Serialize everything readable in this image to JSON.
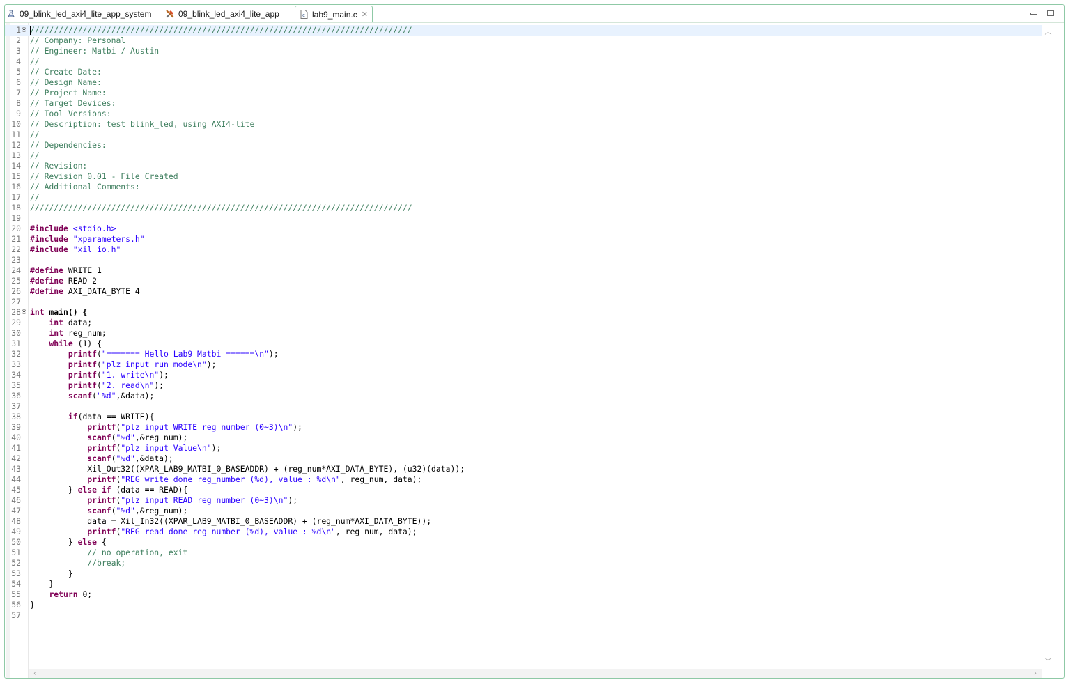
{
  "tabs": [
    {
      "label": "09_blink_led_axi4_lite_app_system",
      "icon": "system-project-icon",
      "active": false
    },
    {
      "label": "09_blink_led_axi4_lite_app",
      "icon": "application-project-icon",
      "active": false
    },
    {
      "label": "lab9_main.c",
      "icon": "c-file-icon",
      "active": true,
      "closable": true
    }
  ],
  "window_controls": {
    "minimize": "minimize-icon",
    "maximize": "maximize-icon"
  },
  "colors": {
    "comment": "#3f7f5f",
    "keyword": "#7f0055",
    "string": "#2a00ff",
    "line_number": "#787878",
    "tab_border": "#8fc9a6",
    "current_line": "#e8f2fe"
  },
  "code": {
    "lines": [
      {
        "n": "1",
        "text": "////////////////////////////////////////////////////////////////////////////////",
        "kind": "com",
        "fold": true
      },
      {
        "n": "2",
        "text": "// Company: Personal",
        "kind": "com"
      },
      {
        "n": "3",
        "text": "// Engineer: Matbi / Austin",
        "kind": "com"
      },
      {
        "n": "4",
        "text": "//",
        "kind": "com"
      },
      {
        "n": "5",
        "text": "// Create Date:",
        "kind": "com"
      },
      {
        "n": "6",
        "text": "// Design Name:",
        "kind": "com"
      },
      {
        "n": "7",
        "text": "// Project Name:",
        "kind": "com"
      },
      {
        "n": "8",
        "text": "// Target Devices:",
        "kind": "com"
      },
      {
        "n": "9",
        "text": "// Tool Versions:",
        "kind": "com"
      },
      {
        "n": "10",
        "text": "// Description: test blink_led, using AXI4-lite",
        "kind": "com"
      },
      {
        "n": "11",
        "text": "//",
        "kind": "com"
      },
      {
        "n": "12",
        "text": "// Dependencies:",
        "kind": "com"
      },
      {
        "n": "13",
        "text": "//",
        "kind": "com"
      },
      {
        "n": "14",
        "text": "// Revision:",
        "kind": "com"
      },
      {
        "n": "15",
        "text": "// Revision 0.01 - File Created",
        "kind": "com"
      },
      {
        "n": "16",
        "text": "// Additional Comments:",
        "kind": "com"
      },
      {
        "n": "17",
        "text": "//",
        "kind": "com"
      },
      {
        "n": "18",
        "text": "////////////////////////////////////////////////////////////////////////////////",
        "kind": "com"
      },
      {
        "n": "19",
        "text": "",
        "kind": "plain"
      },
      {
        "n": "20",
        "kw": "#include",
        "rest": " <stdio.h>",
        "kind": "inc"
      },
      {
        "n": "21",
        "kw": "#include",
        "rest": " \"xparameters.h\"",
        "kind": "inc"
      },
      {
        "n": "22",
        "kw": "#include",
        "rest": " \"xil_io.h\"",
        "kind": "inc"
      },
      {
        "n": "23",
        "text": "",
        "kind": "plain"
      },
      {
        "n": "24",
        "kw": "#define",
        "rest": " WRITE 1",
        "kind": "def"
      },
      {
        "n": "25",
        "kw": "#define",
        "rest": " READ 2",
        "kind": "def"
      },
      {
        "n": "26",
        "kw": "#define",
        "rest": " AXI_DATA_BYTE 4",
        "kind": "def"
      },
      {
        "n": "27",
        "text": "",
        "kind": "plain"
      },
      {
        "n": "28",
        "kw": "int",
        "rest": " main() {",
        "kind": "main",
        "fold": true
      },
      {
        "n": "29",
        "indent": "    ",
        "kw": "int",
        "rest": " data;",
        "kind": "decl"
      },
      {
        "n": "30",
        "indent": "    ",
        "kw": "int",
        "rest": " reg_num;",
        "kind": "decl"
      },
      {
        "n": "31",
        "indent": "    ",
        "kw": "while",
        "rest": " (1) {",
        "kind": "decl"
      },
      {
        "n": "32",
        "indent": "        ",
        "fn": "printf",
        "pre": "(",
        "str": "\"======= Hello Lab9 Matbi ======\\n\"",
        "post": ");",
        "kind": "call"
      },
      {
        "n": "33",
        "indent": "        ",
        "fn": "printf",
        "pre": "(",
        "str": "\"plz input run mode\\n\"",
        "post": ");",
        "kind": "call"
      },
      {
        "n": "34",
        "indent": "        ",
        "fn": "printf",
        "pre": "(",
        "str": "\"1. write\\n\"",
        "post": ");",
        "kind": "call"
      },
      {
        "n": "35",
        "indent": "        ",
        "fn": "printf",
        "pre": "(",
        "str": "\"2. read\\n\"",
        "post": ");",
        "kind": "call"
      },
      {
        "n": "36",
        "indent": "        ",
        "fn": "scanf",
        "pre": "(",
        "str": "\"%d\"",
        "post": ",&data);",
        "kind": "call"
      },
      {
        "n": "37",
        "text": "",
        "kind": "plain"
      },
      {
        "n": "38",
        "indent": "        ",
        "kw": "if",
        "rest": "(data == WRITE){",
        "kind": "decl"
      },
      {
        "n": "39",
        "indent": "            ",
        "fn": "printf",
        "pre": "(",
        "str": "\"plz input WRITE reg number (0~3)\\n\"",
        "post": ");",
        "kind": "call"
      },
      {
        "n": "40",
        "indent": "            ",
        "fn": "scanf",
        "pre": "(",
        "str": "\"%d\"",
        "post": ",&reg_num);",
        "kind": "call"
      },
      {
        "n": "41",
        "indent": "            ",
        "fn": "printf",
        "pre": "(",
        "str": "\"plz input Value\\n\"",
        "post": ");",
        "kind": "call"
      },
      {
        "n": "42",
        "indent": "            ",
        "fn": "scanf",
        "pre": "(",
        "str": "\"%d\"",
        "post": ",&data);",
        "kind": "call"
      },
      {
        "n": "43",
        "text": "            Xil_Out32((XPAR_LAB9_MATBI_0_BASEADDR) + (reg_num*AXI_DATA_BYTE), (u32)(data));",
        "kind": "plain"
      },
      {
        "n": "44",
        "indent": "            ",
        "fn": "printf",
        "pre": "(",
        "str": "\"REG write done reg_number (%d), value : %d\\n\"",
        "post": ", reg_num, data);",
        "kind": "call"
      },
      {
        "n": "45",
        "indent": "        } ",
        "kw": "else if",
        "rest": " (data == READ){",
        "kind": "decl"
      },
      {
        "n": "46",
        "indent": "            ",
        "fn": "printf",
        "pre": "(",
        "str": "\"plz input READ reg number (0~3)\\n\"",
        "post": ");",
        "kind": "call"
      },
      {
        "n": "47",
        "indent": "            ",
        "fn": "scanf",
        "pre": "(",
        "str": "\"%d\"",
        "post": ",&reg_num);",
        "kind": "call"
      },
      {
        "n": "48",
        "text": "            data = Xil_In32((XPAR_LAB9_MATBI_0_BASEADDR) + (reg_num*AXI_DATA_BYTE));",
        "kind": "plain"
      },
      {
        "n": "49",
        "indent": "            ",
        "fn": "printf",
        "pre": "(",
        "str": "\"REG read done reg_number (%d), value : %d\\n\"",
        "post": ", reg_num, data);",
        "kind": "call"
      },
      {
        "n": "50",
        "indent": "        } ",
        "kw": "else",
        "rest": " {",
        "kind": "decl"
      },
      {
        "n": "51",
        "indent": "            ",
        "com": "// no operation, exit",
        "kind": "icom"
      },
      {
        "n": "52",
        "indent": "            ",
        "com": "//break;",
        "kind": "icom"
      },
      {
        "n": "53",
        "text": "        }",
        "kind": "plain"
      },
      {
        "n": "54",
        "text": "    }",
        "kind": "plain"
      },
      {
        "n": "55",
        "indent": "    ",
        "kw": "return",
        "rest": " 0;",
        "kind": "decl"
      },
      {
        "n": "56",
        "text": "}",
        "kind": "plain"
      },
      {
        "n": "57",
        "text": "",
        "kind": "plain"
      }
    ]
  }
}
